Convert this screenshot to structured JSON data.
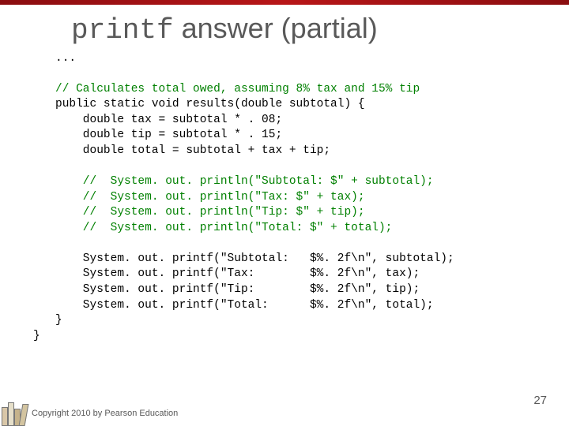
{
  "title": {
    "mono": "printf",
    "rest": " answer (partial)"
  },
  "code": {
    "l0": "...",
    "l1": "",
    "l2c": "// Calculates total owed, assuming 8% tax and 15% tip",
    "l3": "public static void results(double subtotal) {",
    "l4": "    double tax = subtotal * . 08;",
    "l5": "    double tip = subtotal * . 15;",
    "l6": "    double total = subtotal + tax + tip;",
    "l7": "",
    "l8c": "    //  System. out. println(\"Subtotal: $\" + subtotal);",
    "l9c": "    //  System. out. println(\"Tax: $\" + tax);",
    "l10c": "    //  System. out. println(\"Tip: $\" + tip);",
    "l11c": "    //  System. out. println(\"Total: $\" + total);",
    "l12": "",
    "l13": "    System. out. printf(\"Subtotal:   $%. 2f\\n\", subtotal);",
    "l14": "    System. out. printf(\"Tax:        $%. 2f\\n\", tax);",
    "l15": "    System. out. printf(\"Tip:        $%. 2f\\n\", tip);",
    "l16": "    System. out. printf(\"Total:      $%. 2f\\n\", total);",
    "l17": "}"
  },
  "brace_close": "}",
  "footer": "Copyright 2010 by Pearson Education",
  "page": "27"
}
